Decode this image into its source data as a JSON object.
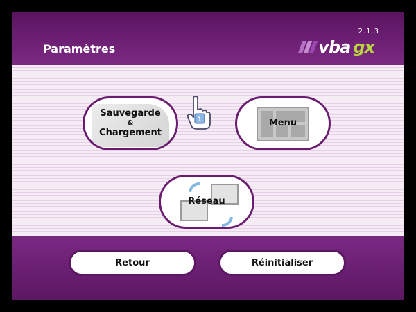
{
  "header": {
    "title": "Paramètres",
    "version": "2.1.3",
    "logo_vba": "vba",
    "logo_gx": "gx",
    "logo_stripe_colors": [
      "#b470c4",
      "#c78ed4",
      "#9a4aae"
    ]
  },
  "tiles": {
    "save_line1": "Sauvegarde",
    "save_amp": "&",
    "save_line2": "Chargement",
    "menu": "Menu",
    "network": "Réseau"
  },
  "footer": {
    "back": "Retour",
    "reset": "Réinitialiser"
  },
  "colors": {
    "accent": "#6a1d70",
    "logo_green": "#b8d640",
    "background_stripe": "#e8cfe8"
  },
  "icons": {
    "cursor": "pointing-hand-icon"
  }
}
